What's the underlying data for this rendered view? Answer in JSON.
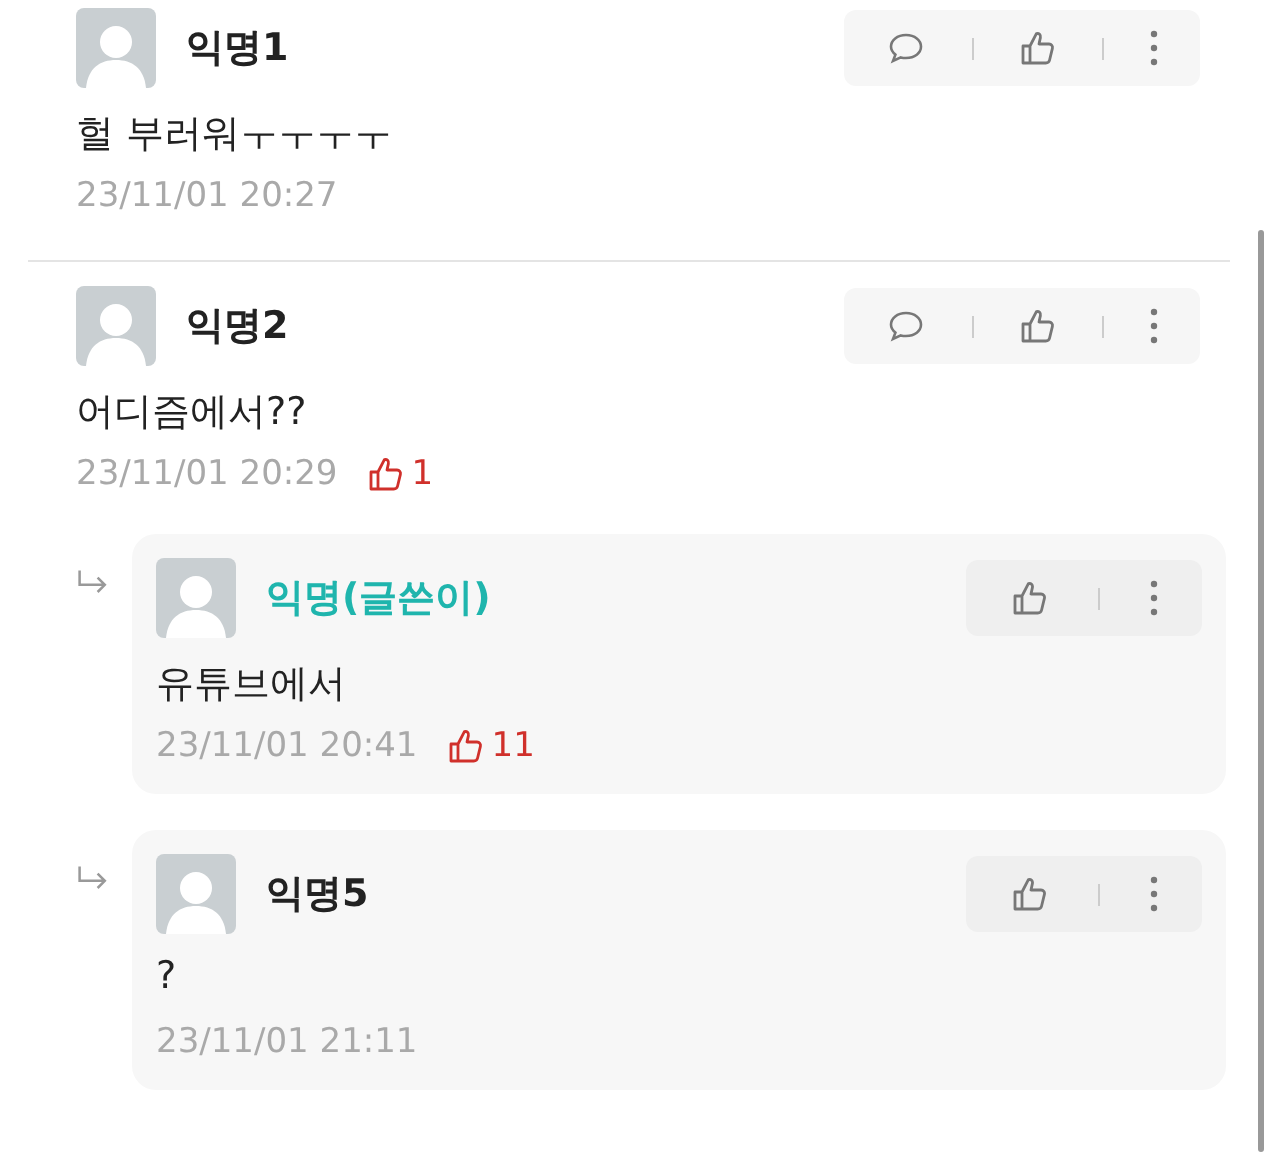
{
  "comments": [
    {
      "kind": "comment",
      "author": "익명1",
      "is_writer": false,
      "text": "헐 부러워ㅜㅜㅜㅜ",
      "time": "23/11/01 20:27"
    },
    {
      "kind": "comment",
      "author": "익명2",
      "is_writer": false,
      "text": "어디즘에서??",
      "time": "23/11/01 20:29",
      "likes": "1",
      "children": [
        {
          "kind": "reply",
          "author": "익명(글쓴이)",
          "is_writer": true,
          "text": "유튜브에서",
          "time": "23/11/01 20:41",
          "likes": "11"
        },
        {
          "kind": "reply",
          "author": "익명5",
          "is_writer": false,
          "text": "?",
          "time": "23/11/01 21:11"
        }
      ]
    }
  ]
}
